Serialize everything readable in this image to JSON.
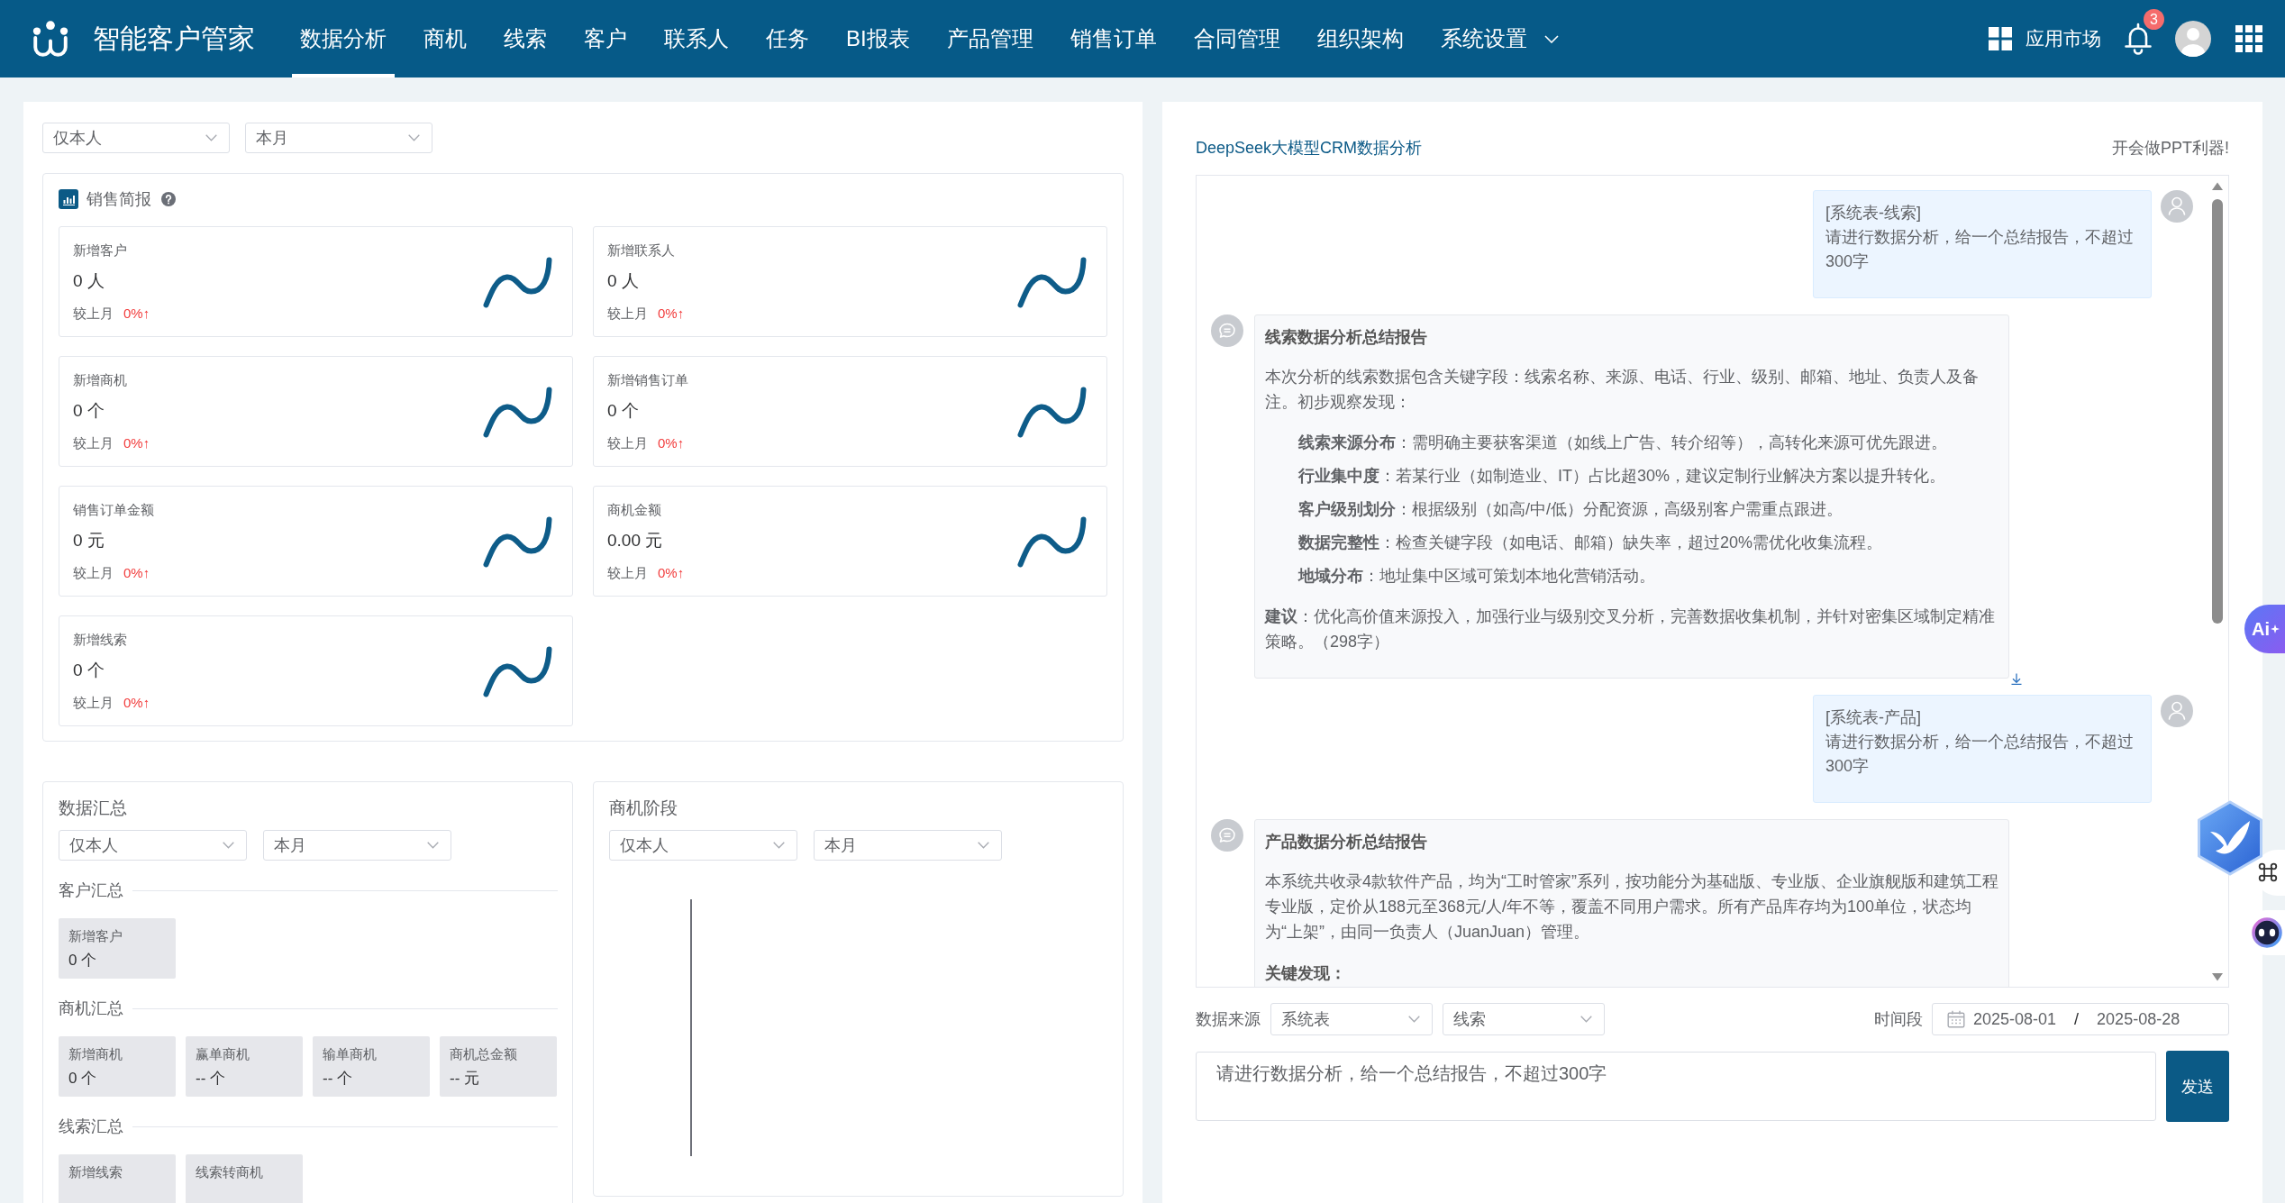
{
  "header": {
    "app_title": "智能客户管家",
    "nav": [
      {
        "label": "数据分析",
        "selected": true,
        "dropdown": false
      },
      {
        "label": "商机",
        "selected": false,
        "dropdown": false
      },
      {
        "label": "线索",
        "selected": false,
        "dropdown": false
      },
      {
        "label": "客户",
        "selected": false,
        "dropdown": false
      },
      {
        "label": "联系人",
        "selected": false,
        "dropdown": false
      },
      {
        "label": "任务",
        "selected": false,
        "dropdown": false
      },
      {
        "label": "BI报表",
        "selected": false,
        "dropdown": false
      },
      {
        "label": "产品管理",
        "selected": false,
        "dropdown": false
      },
      {
        "label": "销售订单",
        "selected": false,
        "dropdown": false
      },
      {
        "label": "合同管理",
        "selected": false,
        "dropdown": false
      },
      {
        "label": "组织架构",
        "selected": false,
        "dropdown": false
      },
      {
        "label": "系统设置",
        "selected": false,
        "dropdown": true
      }
    ],
    "app_market": "应用市场",
    "notification_count": "3"
  },
  "filters": [
    "仅本人",
    "本月"
  ],
  "sales_brief": {
    "title": "销售简报",
    "cards": [
      {
        "label": "新增客户",
        "value": "0 人",
        "compare_label": "较上月",
        "change": "0%↑"
      },
      {
        "label": "新增联系人",
        "value": "0 人",
        "compare_label": "较上月",
        "change": "0%↑"
      },
      {
        "label": "新增商机",
        "value": "0 个",
        "compare_label": "较上月",
        "change": "0%↑"
      },
      {
        "label": "新增销售订单",
        "value": "0 个",
        "compare_label": "较上月",
        "change": "0%↑"
      },
      {
        "label": "销售订单金额",
        "value": "0 元",
        "compare_label": "较上月",
        "change": "0%↑"
      },
      {
        "label": "商机金额",
        "value": "0.00 元",
        "compare_label": "较上月",
        "change": "0%↑"
      },
      {
        "label": "新增线索",
        "value": "0 个",
        "compare_label": "较上月",
        "change": "0%↑"
      }
    ]
  },
  "data_summary": {
    "title": "数据汇总",
    "filters": [
      "仅本人",
      "本月"
    ],
    "groups": [
      {
        "title": "客户汇总",
        "tiles": [
          {
            "label": "新增客户",
            "value": "0 个"
          }
        ]
      },
      {
        "title": "商机汇总",
        "tiles": [
          {
            "label": "新增商机",
            "value": "0 个"
          },
          {
            "label": "赢单商机",
            "value": "-- 个"
          },
          {
            "label": "输单商机",
            "value": "-- 个"
          },
          {
            "label": "商机总金额",
            "value": "-- 元"
          }
        ]
      },
      {
        "title": "线索汇总",
        "tiles": [
          {
            "label": "新增线索"
          },
          {
            "label": "线索转商机"
          }
        ]
      }
    ]
  },
  "opportunity_stage": {
    "title": "商机阶段",
    "filters": [
      "仅本人",
      "本月"
    ]
  },
  "ai_analysis": {
    "title": "DeepSeek大模型CRM数据分析",
    "tagline": "开会做PPT利器!",
    "messages": [
      {
        "kind": "user",
        "tag": "[系统表-线索]",
        "text": "请进行数据分析，给一个总结报告，不超过300字"
      },
      {
        "kind": "assistant",
        "download": true,
        "blocks": [
          {
            "kind": "heading",
            "text": "线索数据分析总结报告"
          },
          {
            "kind": "paragraph",
            "text": "本次分析的线索数据包含关键字段：线索名称、来源、电话、行业、级别、邮箱、地址、负责人及备注。初步观察发现："
          },
          {
            "kind": "list",
            "items": [
              "**线索来源分布**：需明确主要获客渠道（如线上广告、转介绍等），高转化来源可优先跟进。",
              "**行业集中度**：若某行业（如制造业、IT）占比超30%，建议定制行业解决方案以提升转化。",
              "**客户级别划分**：根据级别（如高/中/低）分配资源，高级别客户需重点跟进。",
              "**数据完整性**：检查关键字段（如电话、邮箱）缺失率，超过20%需优化收集流程。",
              "**地域分布**：地址集中区域可策划本地化营销活动。"
            ]
          },
          {
            "kind": "paragraph",
            "text": "**建议**：优化高价值来源投入，加强行业与级别交叉分析，完善数据收集机制，并针对密集区域制定精准策略。（298字）"
          }
        ]
      },
      {
        "kind": "user",
        "tag": "[系统表-产品]",
        "text": "请进行数据分析，给一个总结报告，不超过300字"
      },
      {
        "kind": "assistant",
        "blocks": [
          {
            "kind": "heading",
            "text": "产品数据分析总结报告"
          },
          {
            "kind": "paragraph",
            "text": "本系统共收录4款软件产品，均为“工时管家”系列，按功能分为基础版、专业版、企业旗舰版和建筑工程专业版，定价从188元至368元/人/年不等，覆盖不同用户需求。所有产品库存均为100单位，状态均为“上架”，由同一负责人（JuanJuan）管理。"
          },
          {
            "kind": "heading",
            "text": "关键发现："
          }
        ]
      }
    ],
    "data_source": {
      "label": "数据来源",
      "selects": [
        "系统表",
        "线索"
      ]
    },
    "time_range": {
      "label": "时间段",
      "start": "2025-08-01",
      "separator": "/",
      "end": "2025-08-28"
    },
    "prompt": {
      "value": "请进行数据分析，给一个总结报告，不超过300字"
    },
    "send_button": "发送"
  },
  "floating_tools": {
    "ai_button": "Ai"
  }
}
